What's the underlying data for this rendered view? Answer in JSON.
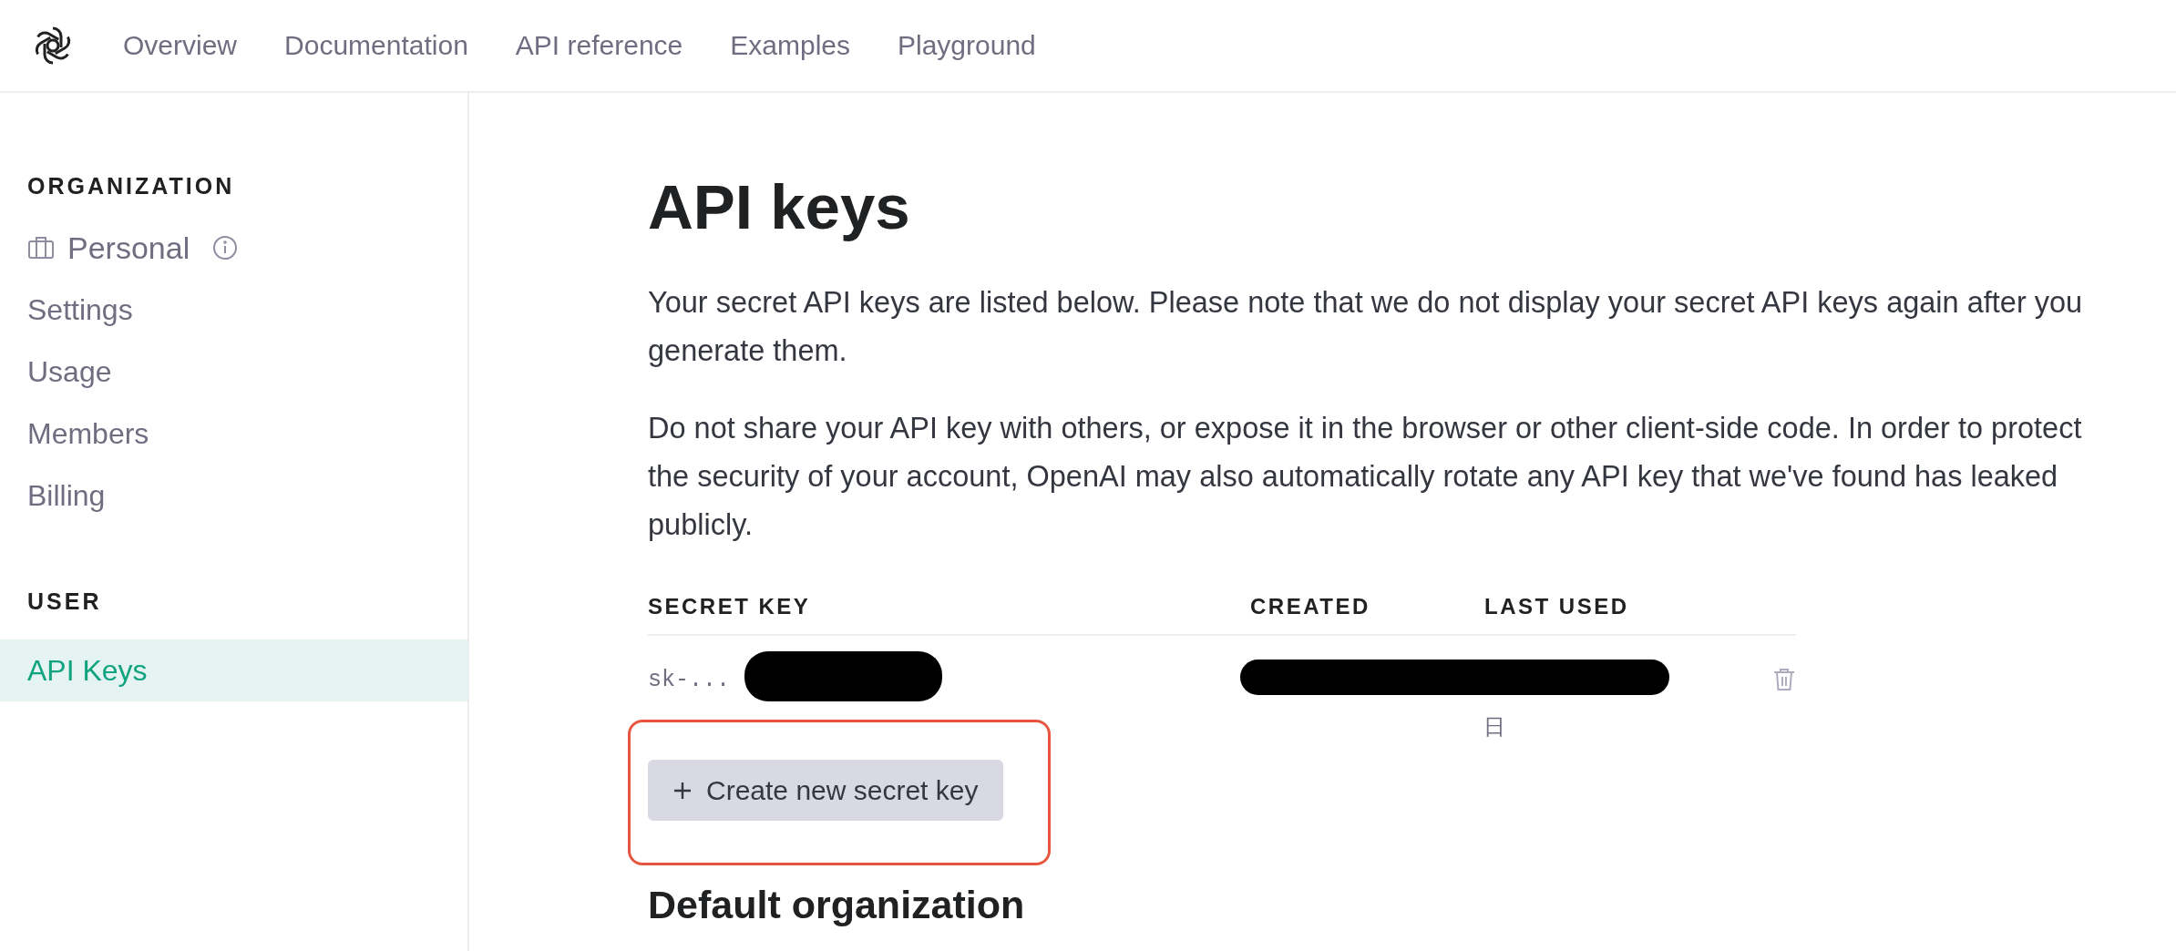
{
  "nav": {
    "items": [
      "Overview",
      "Documentation",
      "API reference",
      "Examples",
      "Playground"
    ]
  },
  "sidebar": {
    "sections": [
      {
        "heading": "ORGANIZATION",
        "items": [
          {
            "label": "Personal",
            "kind": "org",
            "selected": false
          },
          {
            "label": "Settings",
            "kind": "link",
            "selected": false
          },
          {
            "label": "Usage",
            "kind": "link",
            "selected": false
          },
          {
            "label": "Members",
            "kind": "link",
            "selected": false
          },
          {
            "label": "Billing",
            "kind": "link",
            "selected": false
          }
        ]
      },
      {
        "heading": "USER",
        "items": [
          {
            "label": "API Keys",
            "kind": "link",
            "selected": true
          }
        ]
      }
    ]
  },
  "main": {
    "title": "API keys",
    "paragraphs": [
      "Your secret API keys are listed below. Please note that we do not display your secret API keys again after you generate them.",
      "Do not share your API key with others, or expose it in the browser or other client-side code. In order to protect the security of your account, OpenAI may also automatically rotate any API key that we've found has leaked publicly."
    ],
    "table": {
      "columns": [
        "SECRET KEY",
        "CREATED",
        "LAST USED"
      ],
      "rows": [
        {
          "secret_key": "sk-...",
          "last_used": "日",
          "key_redacted": true,
          "dates_redacted": true
        }
      ]
    },
    "create_button": {
      "label": "Create new secret key",
      "highlighted": true
    },
    "section_title": "Default organization"
  }
}
